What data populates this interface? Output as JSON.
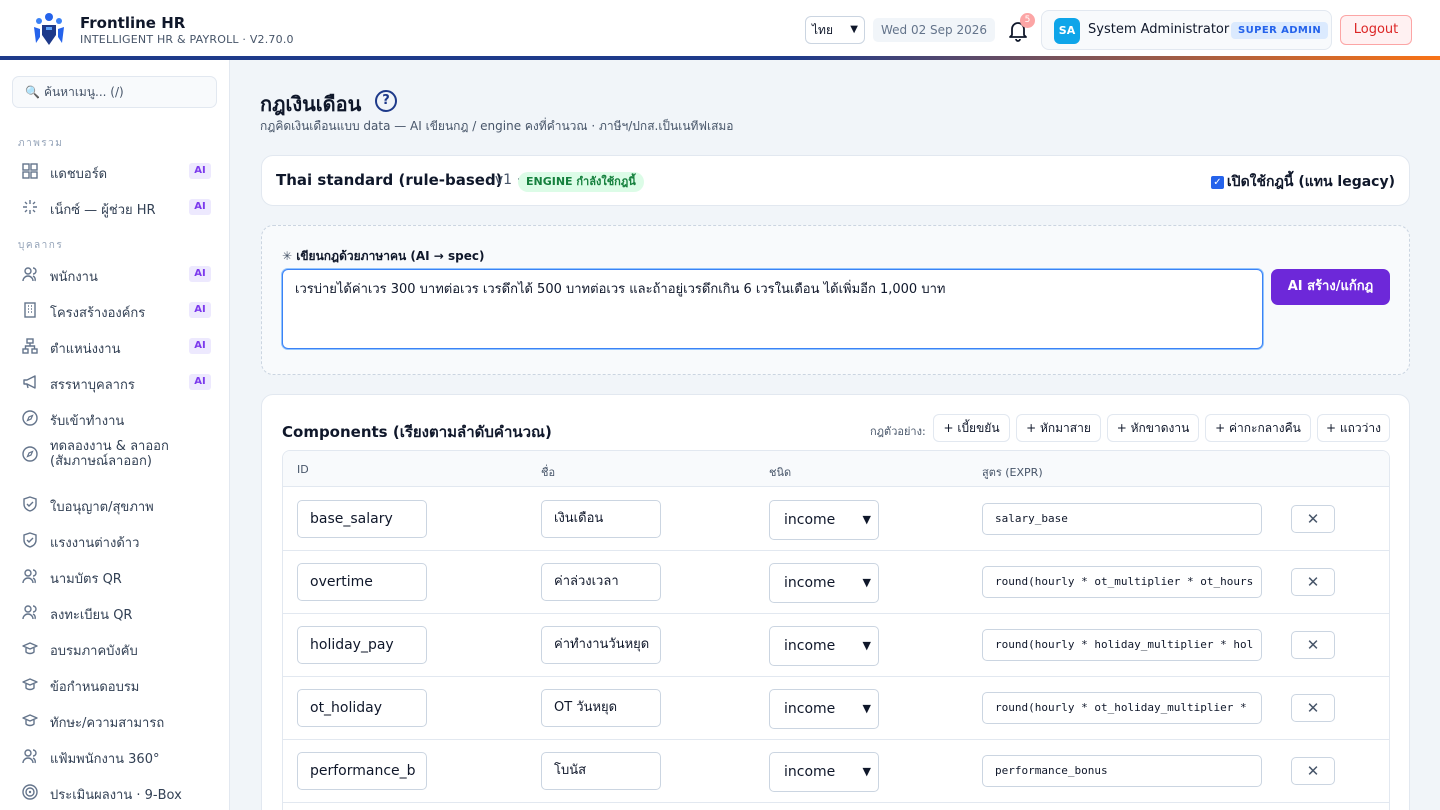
{
  "app": {
    "title": "Frontline HR",
    "subtitle": "INTELLIGENT HR & PAYROLL · V2.70.0",
    "language": "ไทย",
    "date": "Wed 02 Sep 2026",
    "notification_count": "5",
    "user_initials": "SA",
    "user_name": "System Administrator",
    "user_role": "SUPER ADMIN",
    "logout_label": "Logout",
    "brand_color": "#1e3a8a",
    "accent_color": "#f97316"
  },
  "sidebar": {
    "search_placeholder": "ค้นหาเมนู... (/)",
    "sections": {
      "overview": "ภาพรวม",
      "people": "บุคลากร"
    },
    "items": [
      {
        "label": "แดชบอร์ด",
        "icon": "grid-icon",
        "ai": "AI"
      },
      {
        "label": "เน็กซ์ — ผู้ช่วย HR",
        "icon": "sparkle-icon",
        "ai": "AI"
      },
      {
        "label": "พนักงาน",
        "icon": "users-icon",
        "ai": "AI"
      },
      {
        "label": "โครงสร้างองค์กร",
        "icon": "building-icon",
        "ai": "AI"
      },
      {
        "label": "ตำแหน่งงาน",
        "icon": "org-chart-icon",
        "ai": "AI"
      },
      {
        "label": "สรรหาบุคลากร",
        "icon": "megaphone-icon",
        "ai": "AI"
      },
      {
        "label": "รับเข้าทำงาน",
        "icon": "compass-icon",
        "ai": ""
      },
      {
        "label": "ทดลองงาน & ลาออก (สัมภาษณ์ลาออก)",
        "icon": "compass-icon",
        "ai": ""
      },
      {
        "label": "ใบอนุญาต/สุขภาพ",
        "icon": "shield-check-icon",
        "ai": ""
      },
      {
        "label": "แรงงานต่างด้าว",
        "icon": "shield-check-icon",
        "ai": ""
      },
      {
        "label": "นามบัตร QR",
        "icon": "users-icon",
        "ai": ""
      },
      {
        "label": "ลงทะเบียน QR",
        "icon": "users-icon",
        "ai": ""
      },
      {
        "label": "อบรมภาคบังคับ",
        "icon": "graduation-cap-icon",
        "ai": ""
      },
      {
        "label": "ข้อกำหนดอบรม",
        "icon": "graduation-cap-icon",
        "ai": ""
      },
      {
        "label": "ทักษะ/ความสามารถ",
        "icon": "graduation-cap-icon",
        "ai": ""
      },
      {
        "label": "แฟ้มพนักงาน 360°",
        "icon": "users-icon",
        "ai": ""
      },
      {
        "label": "ประเมินผลงาน · 9-Box",
        "icon": "target-icon",
        "ai": ""
      }
    ]
  },
  "page": {
    "title": "กฎเงินเดือน",
    "subtitle": "กฎคิดเงินเดือนแบบ data — AI เขียนกฎ / engine คงที่คำนวณ · ภาษีฯ/ปกส.เป็นเนทีฟเสมอ"
  },
  "engine": {
    "name": "Thai standard (rule-based)",
    "version": "· v1 ·",
    "status": "ENGINE กำลังใช้กฎนี้",
    "toggle_label": "เปิดใช้กฎนี้ (แทน legacy)",
    "toggle_checked": true
  },
  "ai_writer": {
    "heading": "เขียนกฎด้วยภาษาคน (AI → spec)",
    "text": "เวรบ่ายได้ค่าเวร 300 บาทต่อเวร เวรดึกได้ 500 บาทต่อเวร และถ้าอยู่เวรดึกเกิน 6 เวรในเดือน ได้เพิ่มอีก 1,000 บาท",
    "button_label": "AI สร้าง/แก้กฎ"
  },
  "components": {
    "title": "Components (เรียงตามลำดับคำนวณ)",
    "examples_label": "กฎตัวอย่าง:",
    "examples": [
      "+ เบี้ยขยัน",
      "+ หักมาสาย",
      "+ หักขาดงาน",
      "+ ค่ากะกลางคืน",
      "+ แถวว่าง"
    ],
    "headers": {
      "id": "ID",
      "name": "ชื่อ",
      "type": "ชนิด",
      "expr": "สูตร (EXPR)"
    },
    "rows": [
      {
        "id": "base_salary",
        "name": "เงินเดือน",
        "type": "income",
        "expr": "salary_base"
      },
      {
        "id": "overtime",
        "name": "ค่าล่วงเวลา",
        "type": "income",
        "expr": "round(hourly * ot_multiplier * ot_hours"
      },
      {
        "id": "holiday_pay",
        "name": "ค่าทำงานวันหยุด",
        "type": "income",
        "expr": "round(hourly * holiday_multiplier * hol"
      },
      {
        "id": "ot_holiday",
        "name": "OT วันหยุด",
        "type": "income",
        "expr": "round(hourly * ot_holiday_multiplier *"
      },
      {
        "id": "performance_b",
        "name": "โบนัส",
        "type": "income",
        "expr": "performance_bonus"
      }
    ],
    "delete_label": "✕"
  }
}
